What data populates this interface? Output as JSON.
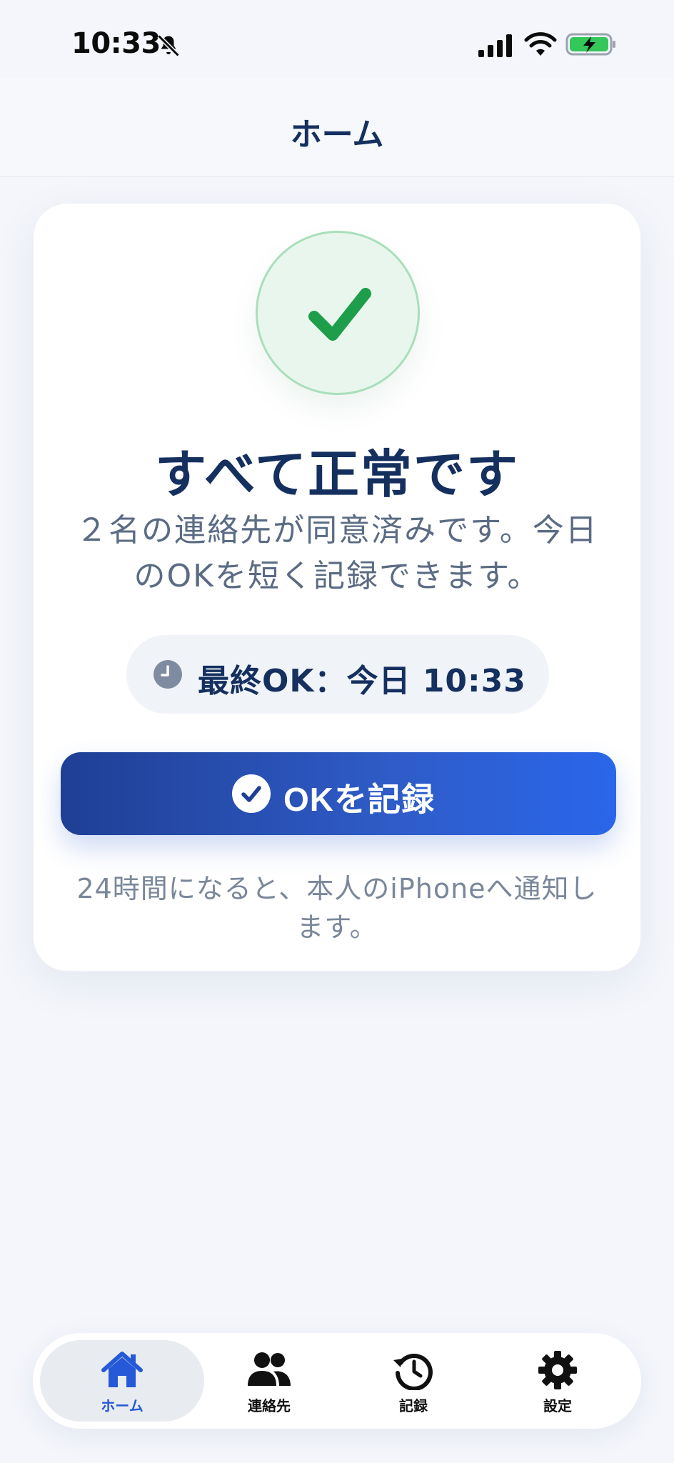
{
  "status_bar": {
    "time": "10:33",
    "icons": [
      "bell-off-icon",
      "signal-icon",
      "wifi-icon",
      "battery-charging-icon"
    ]
  },
  "header": {
    "title": "ホーム"
  },
  "status_card": {
    "icon": "checkmark-icon",
    "title": "すべて正常です",
    "description": "２名の連絡先が同意済みです。今日のOKを短く記録できます。",
    "last_ok": {
      "icon": "clock-icon",
      "text": "最終OK：今日 10:33"
    },
    "record_button": {
      "icon": "check-circle-icon",
      "label": "OKを記録"
    },
    "note": "24時間になると、本人のiPhoneへ通知します。"
  },
  "tab_bar": {
    "items": [
      {
        "label": "ホーム",
        "icon": "home-icon",
        "active": true
      },
      {
        "label": "連絡先",
        "icon": "people-icon",
        "active": false
      },
      {
        "label": "記録",
        "icon": "history-icon",
        "active": false
      },
      {
        "label": "設定",
        "icon": "gear-icon",
        "active": false
      }
    ]
  },
  "colors": {
    "accent": "#2559d8",
    "success": "#1e9e4a",
    "title": "#15305f",
    "background": "#f4f6fb"
  }
}
